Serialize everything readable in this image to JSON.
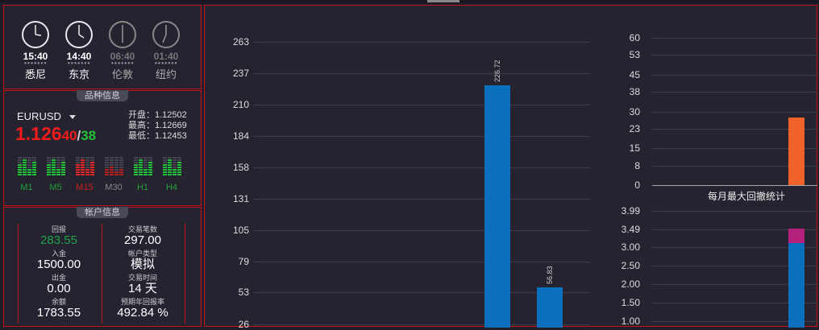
{
  "clocks": [
    {
      "time": "15:40",
      "city": "悉尼",
      "active": true
    },
    {
      "time": "14:40",
      "city": "东京",
      "active": true
    },
    {
      "time": "06:40",
      "city": "伦敦",
      "active": false
    },
    {
      "time": "01:40",
      "city": "纽约",
      "active": false
    }
  ],
  "symbol_panel": {
    "title": "品种信息",
    "symbol": "EURUSD",
    "price_main": "1.126",
    "price_bid_tail": "40",
    "separator": "/",
    "price_ask_tail": "38",
    "open": "开盘：1.12502",
    "high": "最高：1.12669",
    "low": "最低：1.12453",
    "timeframes": [
      {
        "label": "M1",
        "color": "#22c03a"
      },
      {
        "label": "M5",
        "color": "#22c03a"
      },
      {
        "label": "M15",
        "color": "#e0282a"
      },
      {
        "label": "M30",
        "color": "#888888"
      },
      {
        "label": "H1",
        "color": "#22c03a"
      },
      {
        "label": "H4",
        "color": "#22c03a"
      }
    ]
  },
  "account_panel": {
    "title": "帐户信息",
    "profit_label": "回报",
    "profit": "283.55",
    "trades_label": "交易笔数",
    "trades": "297.00",
    "deposit_label": "入金",
    "deposit": "1500.00",
    "type_label": "帐户类型",
    "type": "模拟",
    "withdraw_label": "出金",
    "withdraw": "0.00",
    "days_label": "交易时间",
    "days": "14 天",
    "balance_label": "余额",
    "balance": "1783.55",
    "annual_label": "预期年回报率",
    "annual": "492.84 %"
  },
  "colors": {
    "accent_red": "#c4141a",
    "bar_blue": "#0a6fbd",
    "bar_orange": "#f0622a",
    "bar_magenta": "#b3217d",
    "up_green": "#22c03a"
  },
  "chart_data": [
    {
      "type": "bar",
      "y_ticks": [
        "263",
        "237",
        "210",
        "184",
        "158",
        "131",
        "105",
        "79",
        "53",
        "26"
      ],
      "ylim": [
        26,
        263
      ],
      "bars": [
        {
          "value": 226.72,
          "label": "226.72"
        },
        {
          "value": 56.83,
          "label": "56.83"
        }
      ]
    },
    {
      "type": "bar",
      "title": "每月最大回撤统计",
      "y_ticks": [
        "60",
        "53",
        "45",
        "38",
        "30",
        "23",
        "15",
        "8",
        "0"
      ],
      "ylim": [
        0,
        60
      ],
      "bars": [
        {
          "value": 27.5
        }
      ]
    },
    {
      "type": "bar",
      "y_ticks": [
        "3.99",
        "3.49",
        "3.00",
        "2.50",
        "2.00",
        "1.50",
        "1.00"
      ],
      "ylim": [
        1.0,
        3.99
      ],
      "series": [
        {
          "name": "",
          "values": [
            3.12
          ]
        },
        {
          "name": "",
          "values": [
            3.52
          ]
        }
      ]
    }
  ]
}
